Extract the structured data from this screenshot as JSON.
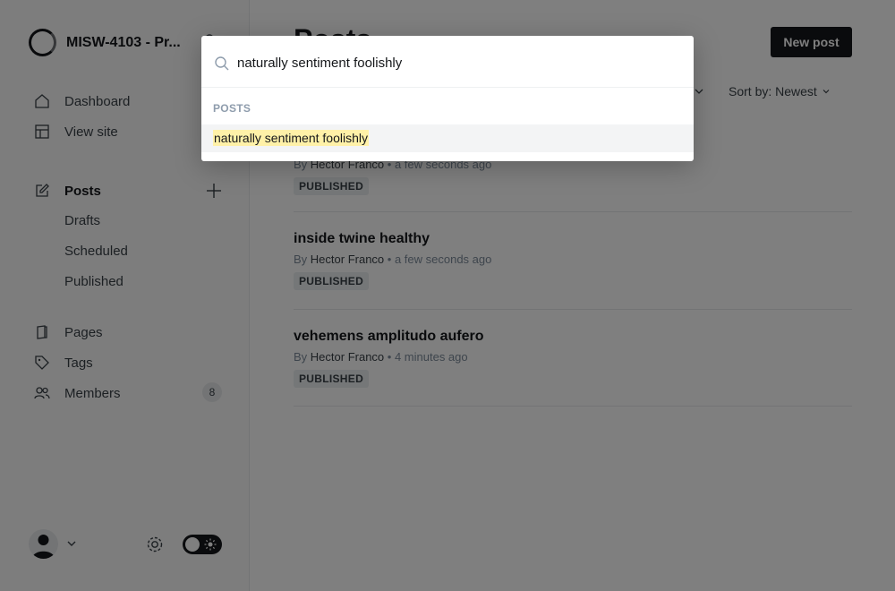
{
  "site": {
    "name": "MISW-4103 - Pr..."
  },
  "sidebar": {
    "items": [
      {
        "label": "Dashboard",
        "icon": "home-icon"
      },
      {
        "label": "View site",
        "icon": "layout-icon"
      },
      {
        "label": "Posts",
        "icon": "edit-icon"
      },
      {
        "label": "Pages",
        "icon": "page-icon"
      },
      {
        "label": "Tags",
        "icon": "tag-icon"
      },
      {
        "label": "Members",
        "icon": "members-icon"
      }
    ],
    "post_subitems": [
      "Drafts",
      "Scheduled",
      "Published"
    ],
    "members_count": "8"
  },
  "main": {
    "title": "Posts",
    "new_post_label": "New post",
    "sort_label": "Sort by: Newest",
    "posts": [
      {
        "title": "naturally sentiment foolishly",
        "by": "By",
        "author": "Hector Franco",
        "time": "a few seconds ago",
        "status": "PUBLISHED"
      },
      {
        "title": "inside twine healthy",
        "by": "By",
        "author": "Hector Franco",
        "time": "a few seconds ago",
        "status": "PUBLISHED"
      },
      {
        "title": "vehemens amplitudo aufero",
        "by": "By",
        "author": "Hector Franco",
        "time": "4 minutes ago",
        "status": "PUBLISHED"
      }
    ]
  },
  "search": {
    "query": "naturally sentiment foolishly",
    "section_label": "POSTS",
    "results": [
      {
        "title": "naturally sentiment foolishly"
      }
    ]
  },
  "colors": {
    "accent": "#15171a",
    "highlight": "#fff1a8",
    "overlay": "rgba(0,0,0,0.5)"
  }
}
